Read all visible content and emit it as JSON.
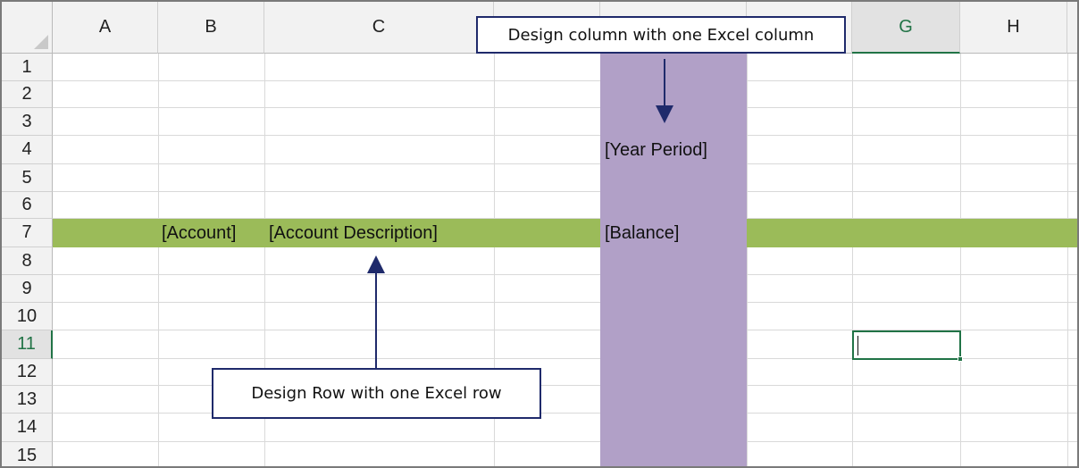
{
  "sheet": {
    "columns": [
      "A",
      "B",
      "C",
      "",
      "",
      "",
      "G",
      "H"
    ],
    "rows": [
      "1",
      "2",
      "3",
      "4",
      "5",
      "6",
      "7",
      "8",
      "9",
      "10",
      "11",
      "12",
      "13",
      "14",
      "15"
    ],
    "active_column": "G",
    "active_row": "11"
  },
  "cells": {
    "account": "[Account]",
    "account_description": "[Account Description]",
    "year_period": "[Year Period]",
    "balance": "[Balance]"
  },
  "callouts": {
    "design_column": "Design column with one Excel column",
    "design_row": "Design Row with one Excel row"
  },
  "colors": {
    "row_highlight": "#9bbb59",
    "column_highlight": "#b1a0c7",
    "selection": "#217346",
    "callout_border": "#1f2a6b"
  }
}
